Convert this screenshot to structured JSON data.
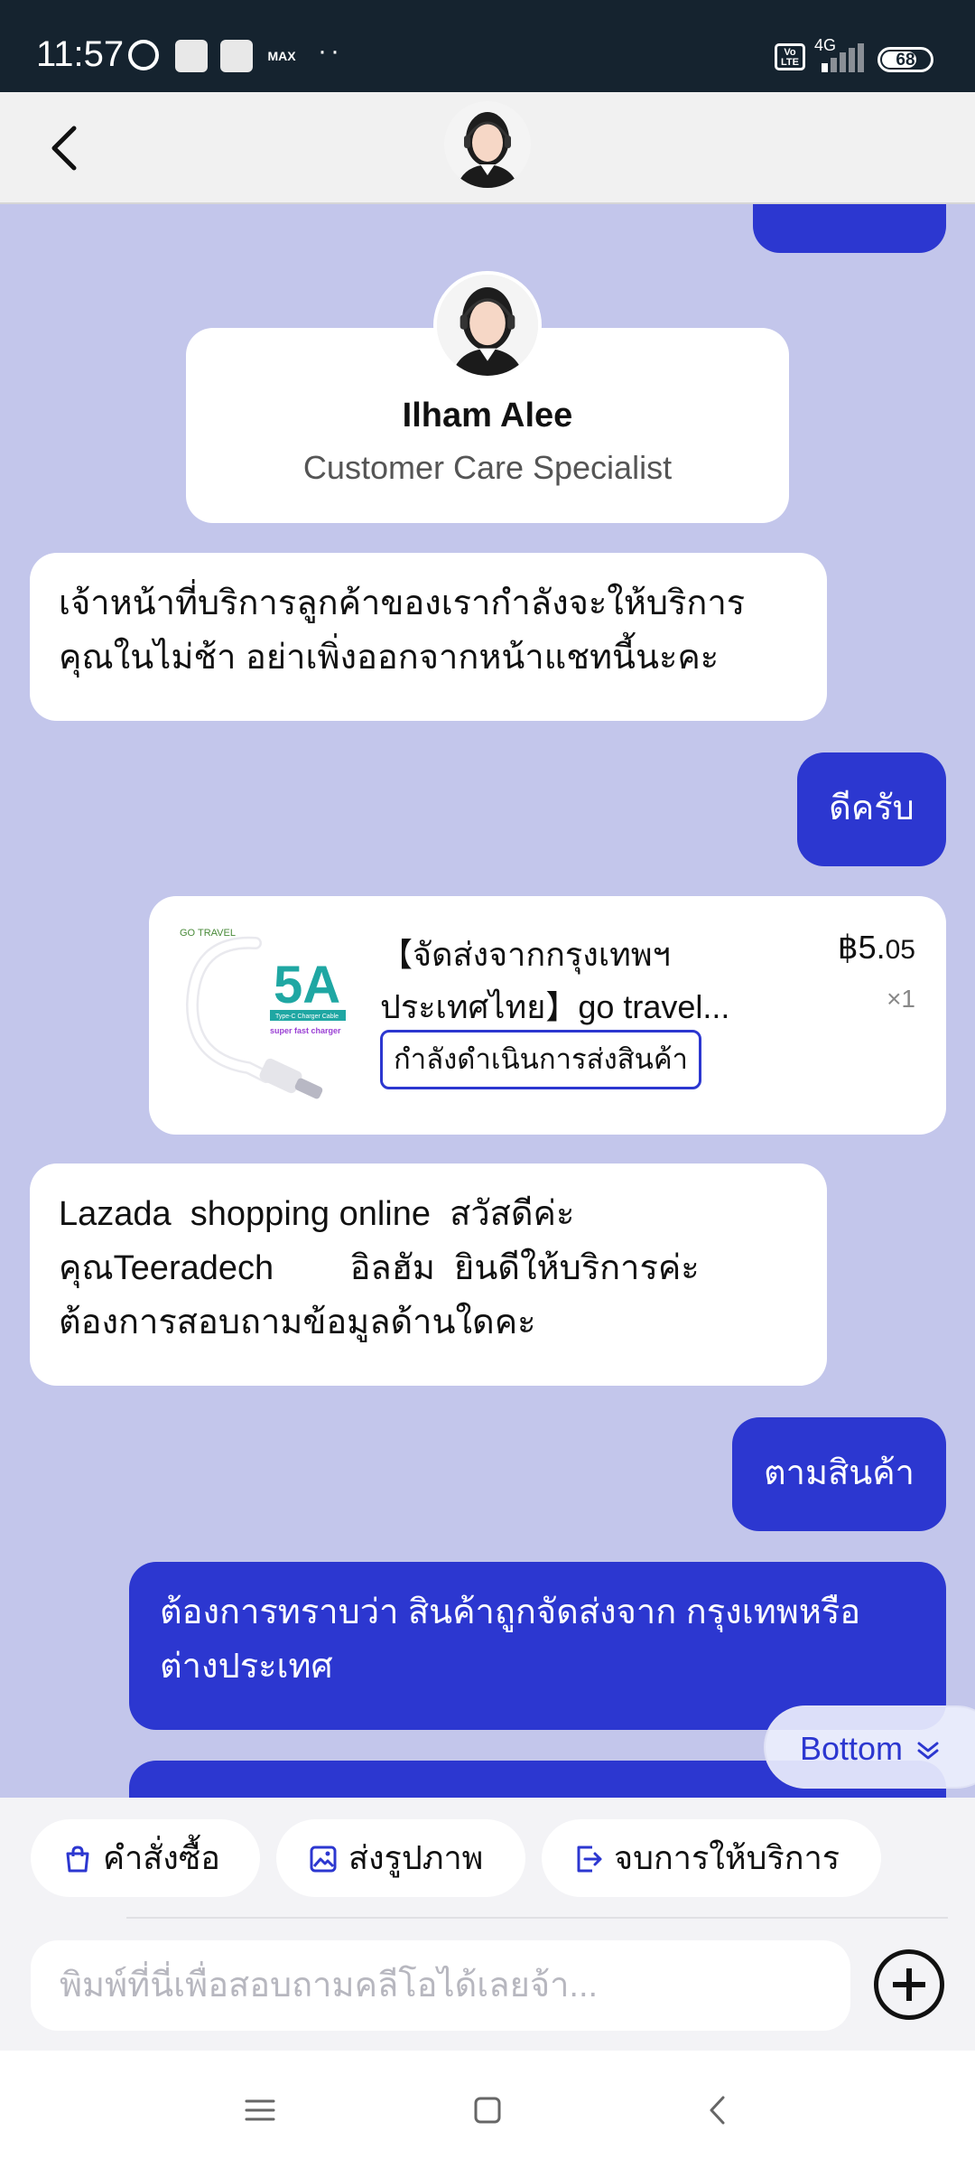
{
  "status_bar": {
    "time": "11:57",
    "network": "4G",
    "volte": "Vo LTE",
    "battery": "68",
    "max_label": "MAX",
    "dots": "··"
  },
  "header": {
    "back_icon": "chevron-left-icon",
    "avatar": "agent-avatar"
  },
  "agent_card": {
    "name": "Ilham Alee",
    "role": "Customer Care Specialist"
  },
  "messages": [
    {
      "side": "in",
      "text_lines": [
        "เจ้าหน้าที่บริการลูกค้าของเรากำลังจะให้บริการ",
        "คุณในไม่ช้า อย่าเพิ่งออกจากหน้าแชทนี้นะคะ"
      ]
    },
    {
      "side": "out",
      "text": "ดีครับ"
    },
    {
      "side": "in",
      "text_lines": [
        "Lazada  shopping online  สวัสดีค่ะ",
        "คุณTeeradech        อิลฮัม  ยินดีให้บริการค่ะ",
        "ต้องการสอบถามข้อมูลด้านใดคะ"
      ]
    },
    {
      "side": "out",
      "text": "ตามสินค้า"
    },
    {
      "side": "out",
      "text_lines": [
        "ต้องการทราบว่า สินค้าถูกจัดส่งจาก กรุงเทพหรือ",
        "ต่างประเทศ"
      ]
    }
  ],
  "order_card": {
    "title_lines": [
      "【จัดส่งจากกรุงเทพฯ",
      "ประเทศไทย】go travel..."
    ],
    "currency": "฿",
    "price_main": "5.",
    "price_cents": "05",
    "quantity": "×1",
    "status": "กำลังดำเนินการส่งสินค้า",
    "thumb": {
      "brand": "GO TRAVEL",
      "big": "5A",
      "sub": "Type-C Charger Cable",
      "tag": "super fast charger"
    }
  },
  "scroll_bottom": {
    "label": "Bottom"
  },
  "quick_actions": [
    {
      "label": "คำสั่งซื้อ",
      "icon": "shopping-bag-icon"
    },
    {
      "label": "ส่งรูปภาพ",
      "icon": "image-icon"
    },
    {
      "label": "จบการให้บริการ",
      "icon": "exit-icon"
    }
  ],
  "input": {
    "placeholder": "พิมพ์ที่นี่เพื่อสอบถามคลีโอได้เลยจ้า...",
    "value": ""
  },
  "colors": {
    "accent": "#2c37d0",
    "chat_bg": "#c3c6eb",
    "status_bar": "#15232f"
  }
}
